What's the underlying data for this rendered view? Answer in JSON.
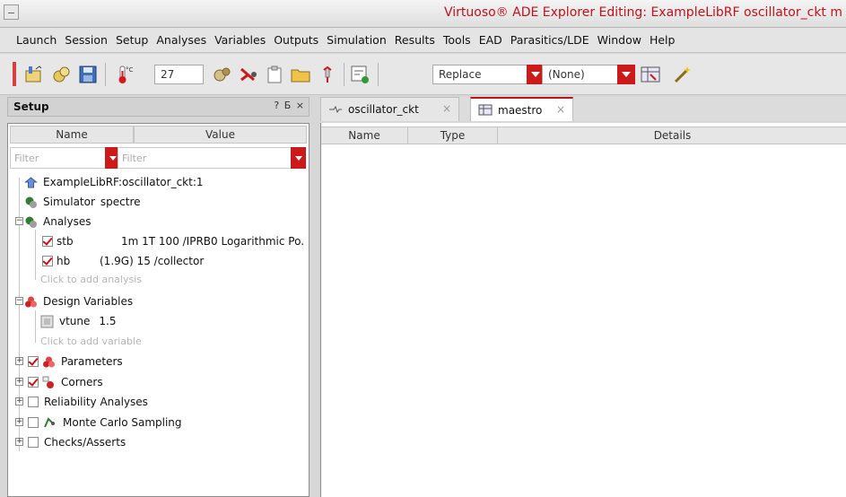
{
  "window": {
    "title": "Virtuoso® ADE Explorer Editing: ExampleLibRF oscillator_ckt m"
  },
  "menu": {
    "items": [
      "Launch",
      "Session",
      "Setup",
      "Analyses",
      "Variables",
      "Outputs",
      "Simulation",
      "Results",
      "Tools",
      "EAD",
      "Parasitics/LDE",
      "Window",
      "Help"
    ]
  },
  "toolbar": {
    "temperature": "27",
    "mode_combo": "Replace",
    "corner_combo": "(None)"
  },
  "setup_panel": {
    "title": "Setup",
    "controls": "? Б ×",
    "col_name": "Name",
    "col_value": "Value",
    "filter_placeholder": "Filter",
    "tree": {
      "cellview": "ExampleLibRF:oscillator_ckt:1",
      "simulator_label": "Simulator",
      "simulator_value": "spectre",
      "analyses_label": "Analyses",
      "analysis_stb_name": "stb",
      "analysis_stb_value": "1m 1T 100 /IPRB0 Logarithmic Po.",
      "analysis_hb_name": "hb",
      "analysis_hb_value": "(1.9G) 15 /collector",
      "add_analysis_hint": "Click to add analysis",
      "design_vars_label": "Design Variables",
      "var_vtune_name": "vtune",
      "var_vtune_value": "1.5",
      "add_variable_hint": "Click to add variable",
      "parameters_label": "Parameters",
      "corners_label": "Corners",
      "reliability_label": "Reliability Analyses",
      "monte_carlo_label": "Monte Carlo Sampling",
      "checks_label": "Checks/Asserts"
    }
  },
  "tabs": [
    {
      "label": "oscillator_ckt"
    },
    {
      "label": "maestro"
    }
  ],
  "main_table": {
    "col_name": "Name",
    "col_type": "Type",
    "col_details": "Details"
  },
  "colors": {
    "accent_red": "#c0121b",
    "check_red": "#d01010"
  }
}
